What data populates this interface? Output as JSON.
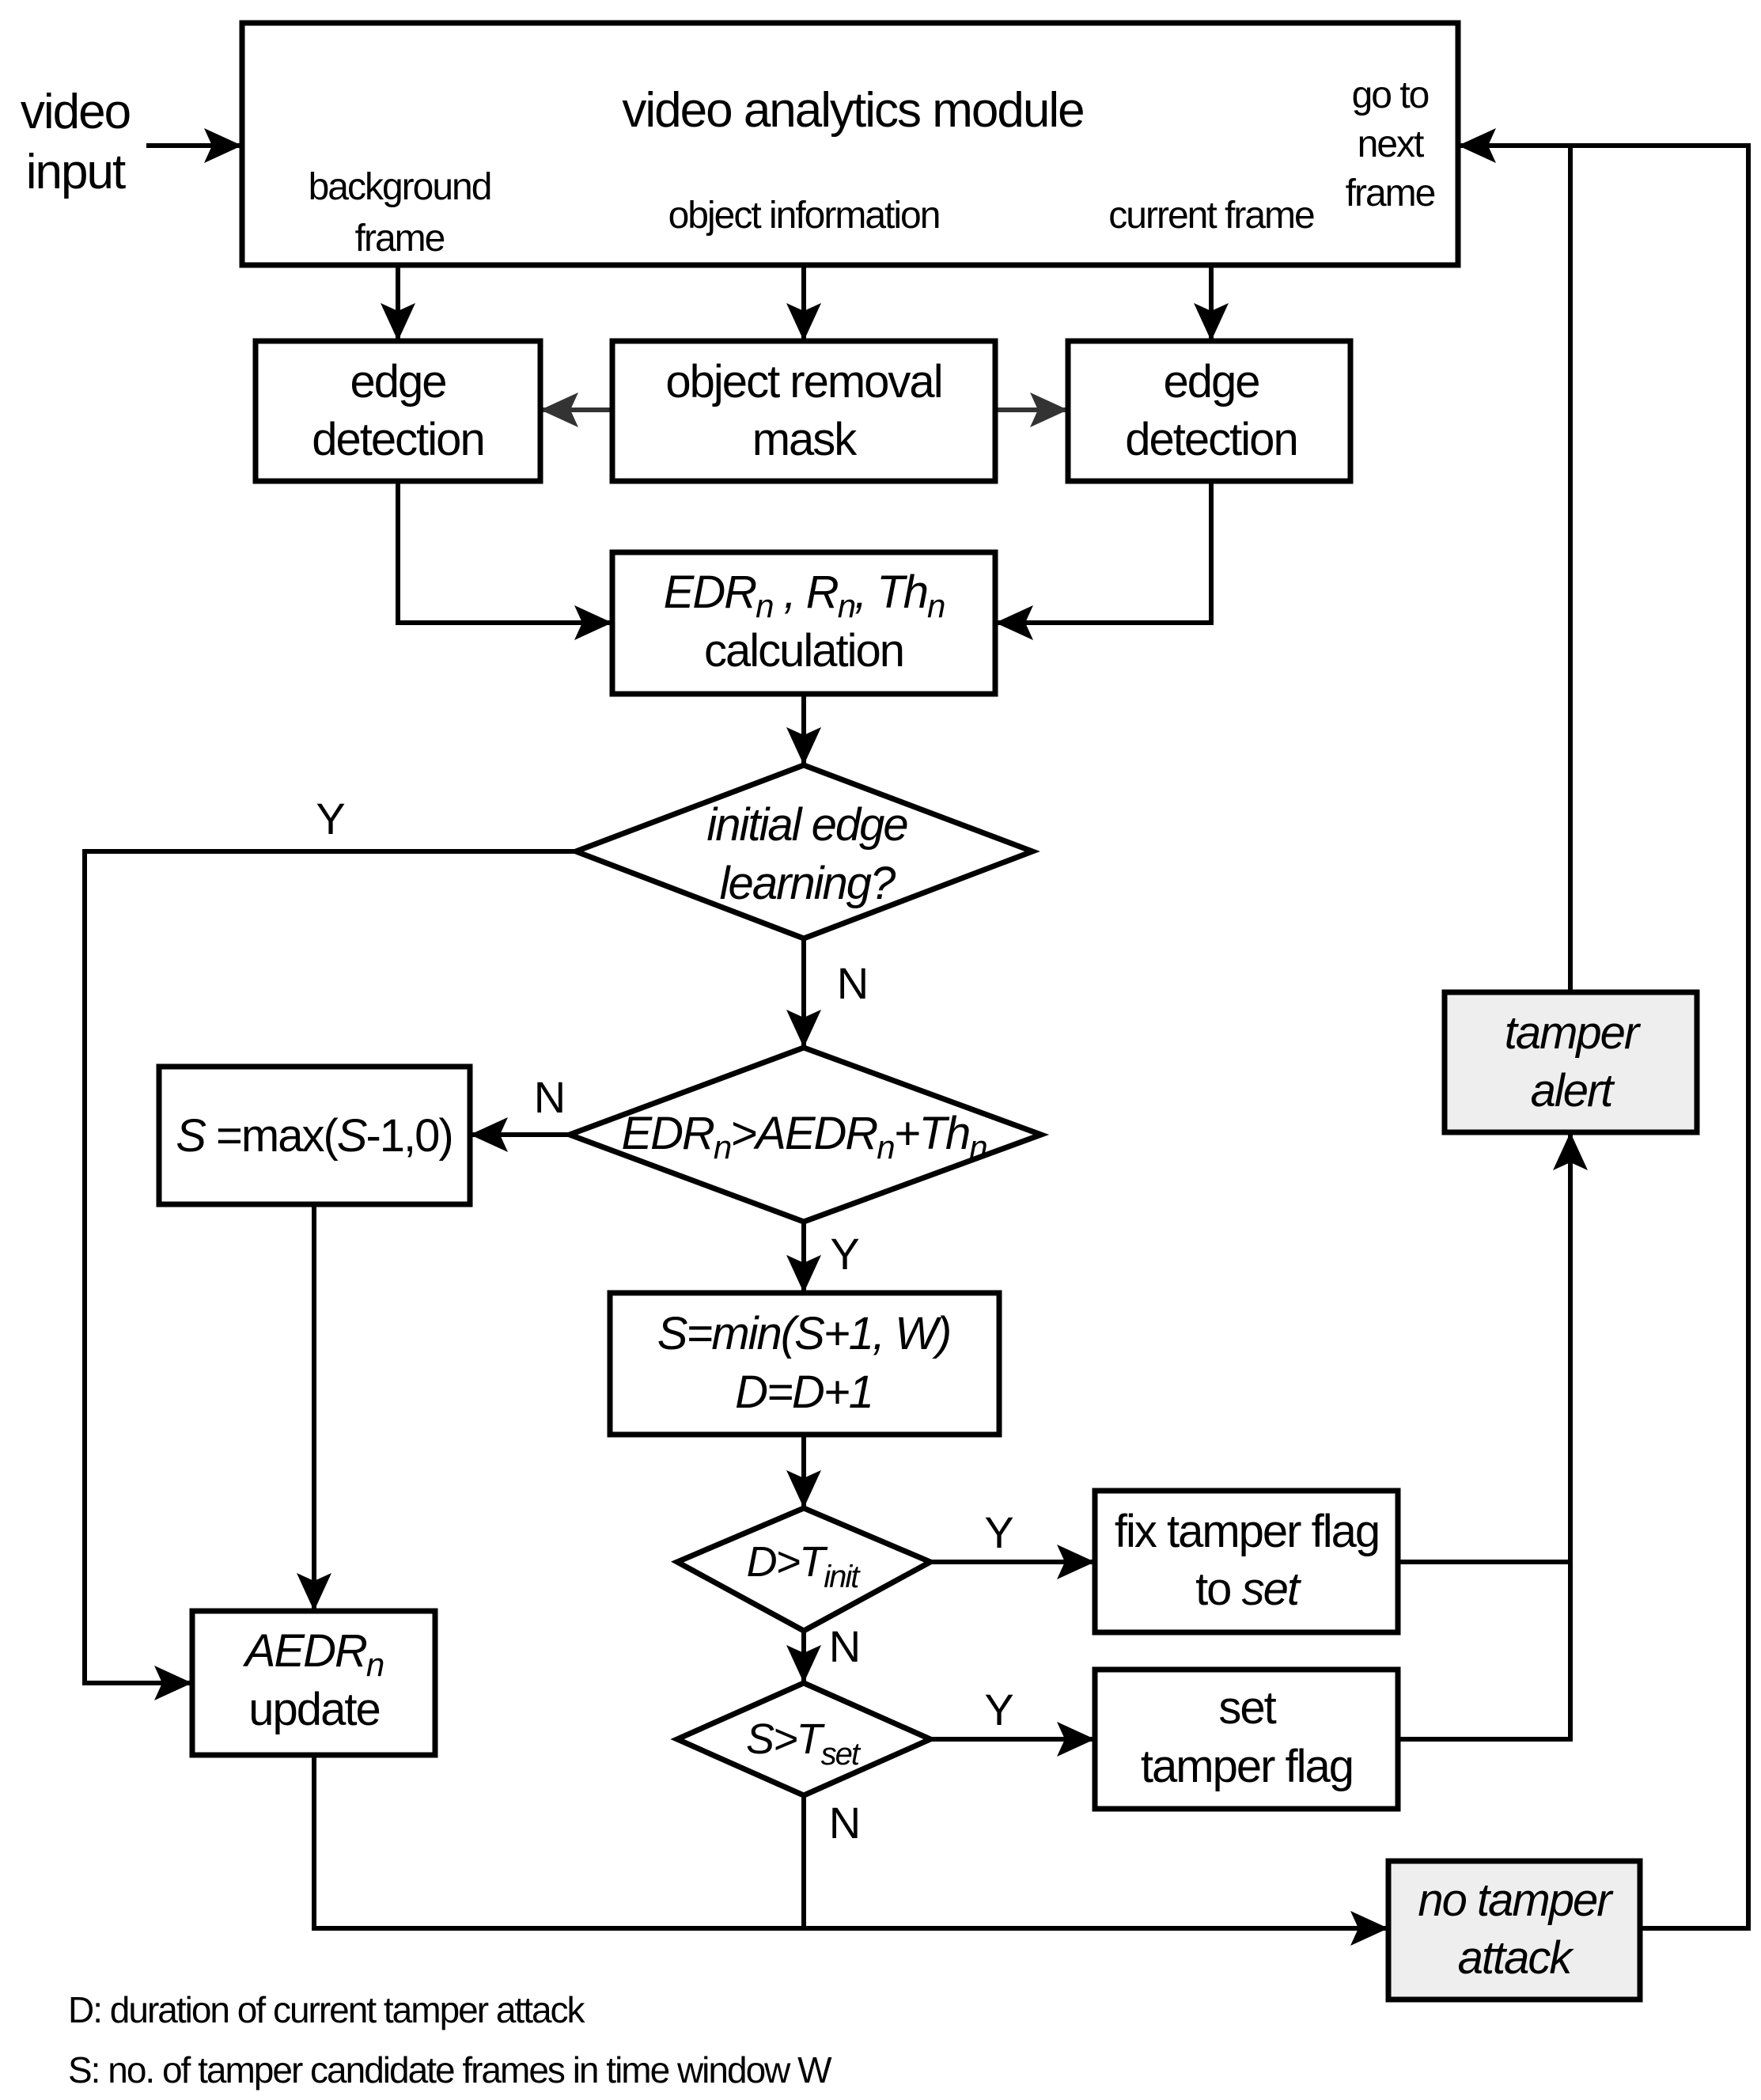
{
  "input_label": [
    "video",
    "input"
  ],
  "module": {
    "title": "video analytics module",
    "outputs": {
      "background": [
        "background",
        "frame"
      ],
      "object": "object information",
      "current": "current frame",
      "next": [
        "go to",
        "next",
        "frame"
      ]
    }
  },
  "nodes": {
    "edge_left": [
      "edge",
      "detection"
    ],
    "object_mask": [
      "object removal",
      "mask"
    ],
    "edge_right": [
      "edge",
      "detection"
    ],
    "calc": {
      "line1_parts": [
        "EDR",
        "n",
        " , R",
        "n",
        ", Th",
        "n"
      ],
      "line2": "calculation"
    },
    "decision_initial": [
      "initial edge",
      "learning?"
    ],
    "decision_edr": {
      "parts": [
        "EDR",
        "n",
        ">AEDR",
        "n",
        "+Th",
        "n"
      ]
    },
    "s_max": {
      "var": "S",
      "rest": " =max(",
      "var2": "S",
      "rest2": "-1,0)"
    },
    "s_min": [
      "S=min(S+1, W)",
      "D=D+1"
    ],
    "decision_d": {
      "main": "D>T",
      "sub": "init"
    },
    "decision_s": {
      "main": "S>T",
      "sub": "set"
    },
    "fix_flag": {
      "line1": "fix tamper flag",
      "line2_prefix": "to ",
      "line2_italic": "set"
    },
    "set_flag": [
      "set",
      "tamper flag"
    ],
    "aedr_update": {
      "main": "AEDR",
      "sub": "n",
      "line2": "update"
    },
    "tamper_alert": [
      "tamper",
      "alert"
    ],
    "no_tamper": [
      "no tamper",
      "attack"
    ]
  },
  "branch_labels": {
    "initial_yes": "Y",
    "initial_no": "N",
    "edr_no": "N",
    "edr_yes": "Y",
    "d_yes": "Y",
    "d_no": "N",
    "s_yes": "Y",
    "s_no": "N"
  },
  "legend": [
    "D: duration of current tamper attack",
    "S: no. of tamper candidate frames in time window W"
  ],
  "colors": {
    "line": "#000000",
    "shaded_fill": "#eeeeee",
    "mask_arrow": "#333333"
  }
}
